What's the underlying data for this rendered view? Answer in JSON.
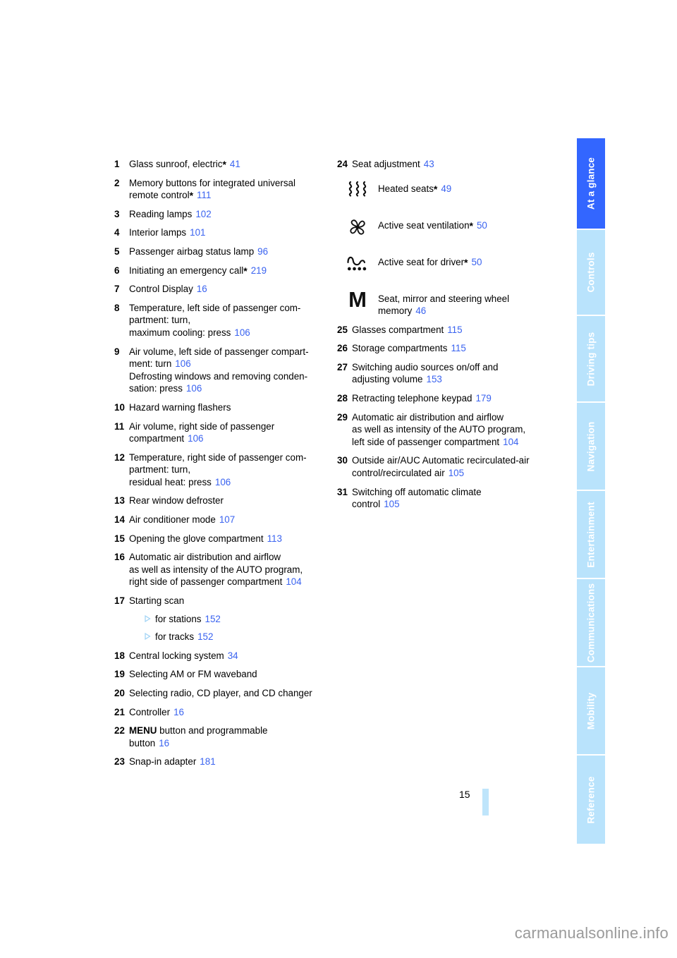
{
  "document": {
    "page_number": "15",
    "watermark": "carmanualsonline.info"
  },
  "sidebar": {
    "tabs": [
      {
        "label": "At a glance",
        "active": true
      },
      {
        "label": "Controls",
        "active": false
      },
      {
        "label": "Driving tips",
        "active": false
      },
      {
        "label": "Navigation",
        "active": false
      },
      {
        "label": "Entertainment",
        "active": false
      },
      {
        "label": "Communications",
        "active": false
      },
      {
        "label": "Mobility",
        "active": false
      },
      {
        "label": "Reference",
        "active": false
      }
    ],
    "active_color": "#3366ff",
    "inactive_color": "#b9e3fc"
  },
  "colors": {
    "page_ref": "#3a63f0",
    "triangle_bullet": "#9ed2f5",
    "page_bar": "#bfe5fb"
  },
  "left_column": {
    "entries": [
      {
        "num": "1",
        "lines": [
          {
            "text": "Glass sunroof, electric",
            "asterisk": true,
            "page": "41"
          }
        ]
      },
      {
        "num": "2",
        "lines": [
          {
            "text": "Memory buttons for integrated universal"
          },
          {
            "text": "remote control",
            "asterisk": true,
            "page": "111"
          }
        ]
      },
      {
        "num": "3",
        "lines": [
          {
            "text": "Reading lamps",
            "page": "102"
          }
        ]
      },
      {
        "num": "4",
        "lines": [
          {
            "text": "Interior lamps",
            "page": "101"
          }
        ]
      },
      {
        "num": "5",
        "lines": [
          {
            "text": "Passenger airbag status lamp",
            "page": "96"
          }
        ]
      },
      {
        "num": "6",
        "lines": [
          {
            "text": "Initiating an emergency call",
            "asterisk": true,
            "page": "219"
          }
        ]
      },
      {
        "num": "7",
        "lines": [
          {
            "text": "Control Display",
            "page": "16"
          }
        ]
      },
      {
        "num": "8",
        "lines": [
          {
            "text": "Temperature, left side of passenger com-"
          },
          {
            "text": "partment: turn,"
          },
          {
            "text": "maximum cooling: press",
            "page": "106"
          }
        ]
      },
      {
        "num": "9",
        "lines": [
          {
            "text": "Air volume, left side of passenger compart-"
          },
          {
            "text": "ment: turn",
            "page": "106"
          },
          {
            "text": "Defrosting windows and removing conden-"
          },
          {
            "text": "sation: press",
            "page": "106"
          }
        ]
      },
      {
        "num": "10",
        "lines": [
          {
            "text": "Hazard warning flashers"
          }
        ]
      },
      {
        "num": "11",
        "lines": [
          {
            "text": "Air volume, right side of passenger"
          },
          {
            "text": "compartment",
            "page": "106"
          }
        ]
      },
      {
        "num": "12",
        "lines": [
          {
            "text": "Temperature, right side of passenger com-"
          },
          {
            "text": "partment: turn,"
          },
          {
            "text": "residual heat: press",
            "page": "106"
          }
        ]
      },
      {
        "num": "13",
        "lines": [
          {
            "text": "Rear window defroster"
          }
        ]
      },
      {
        "num": "14",
        "lines": [
          {
            "text": "Air conditioner mode",
            "page": "107"
          }
        ]
      },
      {
        "num": "15",
        "lines": [
          {
            "text": "Opening the glove compartment",
            "page": "113"
          }
        ]
      },
      {
        "num": "16",
        "lines": [
          {
            "text": "Automatic air distribution and airflow"
          },
          {
            "text": "as well as intensity of the AUTO program,"
          },
          {
            "text": "right side of passenger compartment",
            "page": "104"
          }
        ]
      },
      {
        "num": "17",
        "lines": [
          {
            "text": "Starting scan"
          }
        ],
        "subitems": [
          {
            "text": "for stations",
            "page": "152"
          },
          {
            "text": "for tracks",
            "page": "152"
          }
        ]
      },
      {
        "num": "18",
        "lines": [
          {
            "text": "Central locking system",
            "page": "34"
          }
        ]
      },
      {
        "num": "19",
        "lines": [
          {
            "text": "Selecting AM or FM waveband"
          }
        ]
      },
      {
        "num": "20",
        "lines": [
          {
            "text": "Selecting radio, CD player, and CD changer"
          }
        ]
      },
      {
        "num": "21",
        "lines": [
          {
            "text": "Controller",
            "page": "16"
          }
        ]
      },
      {
        "num": "22",
        "lines": [
          {
            "keyword": "MENU",
            "text": " button and programmable"
          },
          {
            "text": "button",
            "page": "16"
          }
        ]
      },
      {
        "num": "23",
        "lines": [
          {
            "text": "Snap-in adapter",
            "page": "181"
          }
        ]
      }
    ]
  },
  "right_column": {
    "entries_top": [
      {
        "num": "24",
        "lines": [
          {
            "text": "Seat adjustment",
            "page": "43"
          }
        ]
      }
    ],
    "icon_rows": [
      {
        "icon": "heated-seats-icon",
        "lines": [
          {
            "text": "Heated seats",
            "asterisk": true,
            "page": "49"
          }
        ]
      },
      {
        "icon": "seat-ventilation-fan-icon",
        "lines": [
          {
            "text": "Active seat ventilation",
            "asterisk": true,
            "page": "50"
          }
        ]
      },
      {
        "icon": "active-seat-wave-icon",
        "lines": [
          {
            "text": "Active seat for driver",
            "asterisk": true,
            "page": "50"
          }
        ]
      },
      {
        "icon": "memory-m-icon",
        "lines": [
          {
            "text": "Seat, mirror and steering wheel"
          },
          {
            "text": "memory",
            "page": "46"
          }
        ]
      }
    ],
    "entries_bottom": [
      {
        "num": "25",
        "lines": [
          {
            "text": "Glasses compartment",
            "page": "115"
          }
        ]
      },
      {
        "num": "26",
        "lines": [
          {
            "text": "Storage compartments",
            "page": "115"
          }
        ]
      },
      {
        "num": "27",
        "lines": [
          {
            "text": "Switching audio sources on/off and"
          },
          {
            "text": "adjusting volume",
            "page": "153"
          }
        ]
      },
      {
        "num": "28",
        "lines": [
          {
            "text": "Retracting telephone keypad",
            "page": "179"
          }
        ]
      },
      {
        "num": "29",
        "lines": [
          {
            "text": "Automatic air distribution and airflow"
          },
          {
            "text": "as well as intensity of the AUTO program,"
          },
          {
            "text": "left side of passenger compartment",
            "page": "104"
          }
        ]
      },
      {
        "num": "30",
        "lines": [
          {
            "text": "Outside air/AUC Automatic recirculated-air"
          },
          {
            "text": "control/recirculated air",
            "page": "105"
          }
        ]
      },
      {
        "num": "31",
        "lines": [
          {
            "text": "Switching off automatic climate"
          },
          {
            "text": "control",
            "page": "105"
          }
        ]
      }
    ]
  }
}
